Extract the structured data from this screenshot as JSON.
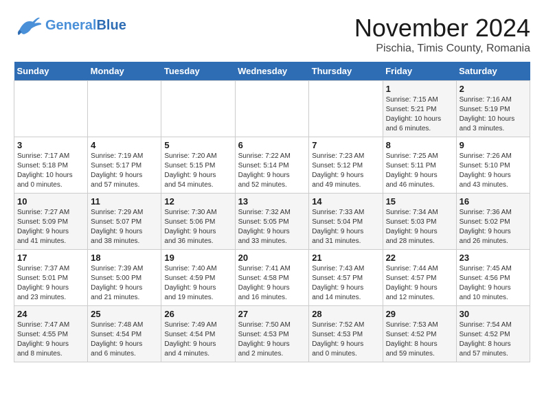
{
  "header": {
    "logo_general": "General",
    "logo_blue": "Blue",
    "month_title": "November 2024",
    "subtitle": "Pischia, Timis County, Romania"
  },
  "weekdays": [
    "Sunday",
    "Monday",
    "Tuesday",
    "Wednesday",
    "Thursday",
    "Friday",
    "Saturday"
  ],
  "weeks": [
    [
      {
        "day": "",
        "info": ""
      },
      {
        "day": "",
        "info": ""
      },
      {
        "day": "",
        "info": ""
      },
      {
        "day": "",
        "info": ""
      },
      {
        "day": "",
        "info": ""
      },
      {
        "day": "1",
        "info": "Sunrise: 7:15 AM\nSunset: 5:21 PM\nDaylight: 10 hours\nand 6 minutes."
      },
      {
        "day": "2",
        "info": "Sunrise: 7:16 AM\nSunset: 5:19 PM\nDaylight: 10 hours\nand 3 minutes."
      }
    ],
    [
      {
        "day": "3",
        "info": "Sunrise: 7:17 AM\nSunset: 5:18 PM\nDaylight: 10 hours\nand 0 minutes."
      },
      {
        "day": "4",
        "info": "Sunrise: 7:19 AM\nSunset: 5:17 PM\nDaylight: 9 hours\nand 57 minutes."
      },
      {
        "day": "5",
        "info": "Sunrise: 7:20 AM\nSunset: 5:15 PM\nDaylight: 9 hours\nand 54 minutes."
      },
      {
        "day": "6",
        "info": "Sunrise: 7:22 AM\nSunset: 5:14 PM\nDaylight: 9 hours\nand 52 minutes."
      },
      {
        "day": "7",
        "info": "Sunrise: 7:23 AM\nSunset: 5:12 PM\nDaylight: 9 hours\nand 49 minutes."
      },
      {
        "day": "8",
        "info": "Sunrise: 7:25 AM\nSunset: 5:11 PM\nDaylight: 9 hours\nand 46 minutes."
      },
      {
        "day": "9",
        "info": "Sunrise: 7:26 AM\nSunset: 5:10 PM\nDaylight: 9 hours\nand 43 minutes."
      }
    ],
    [
      {
        "day": "10",
        "info": "Sunrise: 7:27 AM\nSunset: 5:09 PM\nDaylight: 9 hours\nand 41 minutes."
      },
      {
        "day": "11",
        "info": "Sunrise: 7:29 AM\nSunset: 5:07 PM\nDaylight: 9 hours\nand 38 minutes."
      },
      {
        "day": "12",
        "info": "Sunrise: 7:30 AM\nSunset: 5:06 PM\nDaylight: 9 hours\nand 36 minutes."
      },
      {
        "day": "13",
        "info": "Sunrise: 7:32 AM\nSunset: 5:05 PM\nDaylight: 9 hours\nand 33 minutes."
      },
      {
        "day": "14",
        "info": "Sunrise: 7:33 AM\nSunset: 5:04 PM\nDaylight: 9 hours\nand 31 minutes."
      },
      {
        "day": "15",
        "info": "Sunrise: 7:34 AM\nSunset: 5:03 PM\nDaylight: 9 hours\nand 28 minutes."
      },
      {
        "day": "16",
        "info": "Sunrise: 7:36 AM\nSunset: 5:02 PM\nDaylight: 9 hours\nand 26 minutes."
      }
    ],
    [
      {
        "day": "17",
        "info": "Sunrise: 7:37 AM\nSunset: 5:01 PM\nDaylight: 9 hours\nand 23 minutes."
      },
      {
        "day": "18",
        "info": "Sunrise: 7:39 AM\nSunset: 5:00 PM\nDaylight: 9 hours\nand 21 minutes."
      },
      {
        "day": "19",
        "info": "Sunrise: 7:40 AM\nSunset: 4:59 PM\nDaylight: 9 hours\nand 19 minutes."
      },
      {
        "day": "20",
        "info": "Sunrise: 7:41 AM\nSunset: 4:58 PM\nDaylight: 9 hours\nand 16 minutes."
      },
      {
        "day": "21",
        "info": "Sunrise: 7:43 AM\nSunset: 4:57 PM\nDaylight: 9 hours\nand 14 minutes."
      },
      {
        "day": "22",
        "info": "Sunrise: 7:44 AM\nSunset: 4:57 PM\nDaylight: 9 hours\nand 12 minutes."
      },
      {
        "day": "23",
        "info": "Sunrise: 7:45 AM\nSunset: 4:56 PM\nDaylight: 9 hours\nand 10 minutes."
      }
    ],
    [
      {
        "day": "24",
        "info": "Sunrise: 7:47 AM\nSunset: 4:55 PM\nDaylight: 9 hours\nand 8 minutes."
      },
      {
        "day": "25",
        "info": "Sunrise: 7:48 AM\nSunset: 4:54 PM\nDaylight: 9 hours\nand 6 minutes."
      },
      {
        "day": "26",
        "info": "Sunrise: 7:49 AM\nSunset: 4:54 PM\nDaylight: 9 hours\nand 4 minutes."
      },
      {
        "day": "27",
        "info": "Sunrise: 7:50 AM\nSunset: 4:53 PM\nDaylight: 9 hours\nand 2 minutes."
      },
      {
        "day": "28",
        "info": "Sunrise: 7:52 AM\nSunset: 4:53 PM\nDaylight: 9 hours\nand 0 minutes."
      },
      {
        "day": "29",
        "info": "Sunrise: 7:53 AM\nSunset: 4:52 PM\nDaylight: 8 hours\nand 59 minutes."
      },
      {
        "day": "30",
        "info": "Sunrise: 7:54 AM\nSunset: 4:52 PM\nDaylight: 8 hours\nand 57 minutes."
      }
    ]
  ]
}
